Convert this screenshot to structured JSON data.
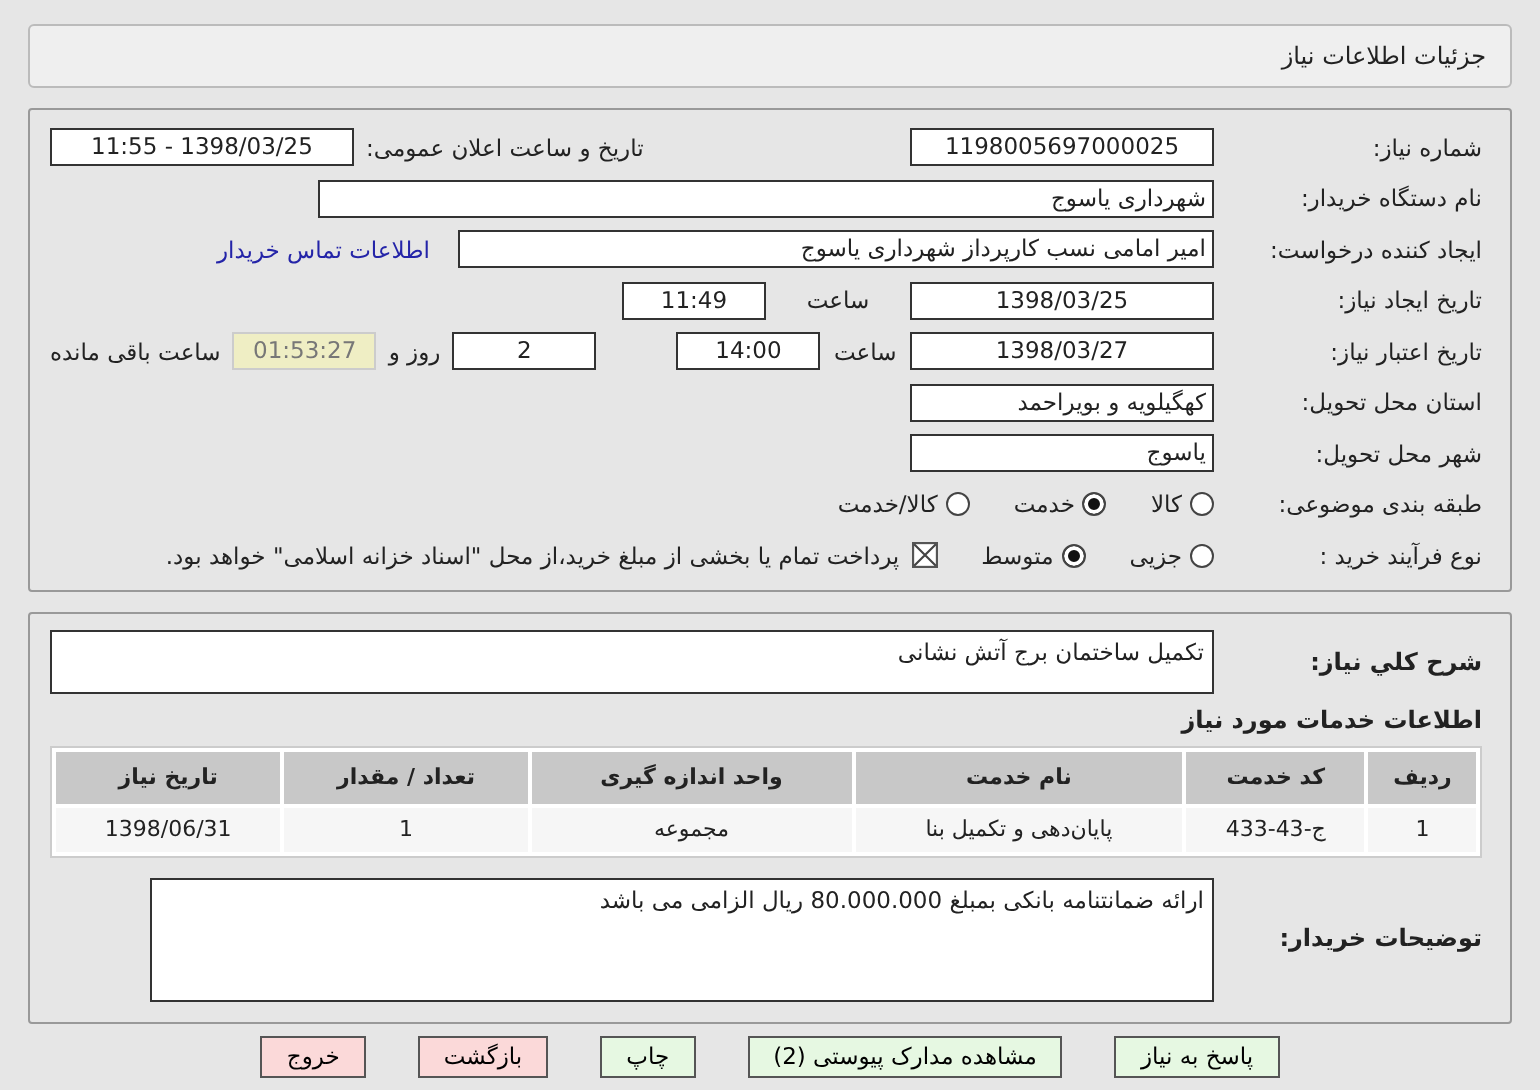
{
  "header": {
    "title": "جزئیات اطلاعات نیاز"
  },
  "details": {
    "need_number": {
      "label": "شماره نیاز:",
      "value": "1198005697000025"
    },
    "announce": {
      "label": "تاریخ و ساعت اعلان عمومی:",
      "value": "1398/03/25 - 11:55"
    },
    "buyer_org": {
      "label": "نام دستگاه خریدار:",
      "value": "شهرداری یاسوج"
    },
    "requester": {
      "label": "ایجاد کننده درخواست:",
      "value": "امیر امامی نسب کارپرداز شهرداری یاسوج",
      "link": "اطلاعات تماس خریدار"
    },
    "created": {
      "label": "تاریخ ایجاد نیاز:",
      "date": "1398/03/25",
      "time_label": "ساعت",
      "time": "11:49"
    },
    "valid": {
      "label": "تاریخ اعتبار نیاز:",
      "date": "1398/03/27",
      "time_label": "ساعت",
      "time": "14:00",
      "days": "2",
      "days_label": "روز و",
      "remaining": "01:53:27",
      "remaining_label": "ساعت باقی مانده"
    },
    "province": {
      "label": "استان محل تحویل:",
      "value": "کهگیلویه و بویراحمد"
    },
    "city": {
      "label": "شهر محل تحویل:",
      "value": "یاسوج"
    },
    "category": {
      "label": "طبقه بندی موضوعی:",
      "options": [
        {
          "label": "کالا",
          "selected": false
        },
        {
          "label": "خدمت",
          "selected": true
        },
        {
          "label": "کالا/خدمت",
          "selected": false
        }
      ]
    },
    "process": {
      "label": "نوع فرآیند خرید :",
      "options": [
        {
          "label": "جزیی",
          "selected": false
        },
        {
          "label": "متوسط",
          "selected": true
        }
      ],
      "treasury": {
        "label": "پرداخت تمام یا بخشی از مبلغ خرید،از محل \"اسناد خزانه اسلامی\" خواهد بود.",
        "checked": true
      }
    }
  },
  "summary": {
    "label": "شرح کلي نیاز:",
    "value": "تکمیل ساختمان برج آتش نشانی"
  },
  "services": {
    "title": "اطلاعات خدمات مورد نیاز",
    "columns": [
      "ردیف",
      "کد خدمت",
      "نام خدمت",
      "واحد اندازه گیری",
      "تعداد / مقدار",
      "تاریخ نیاز"
    ],
    "rows": [
      [
        "1",
        "ج-43-433",
        "پایان‌دهی و تکمیل بنا",
        "مجموعه",
        "1",
        "1398/06/31"
      ]
    ]
  },
  "notes": {
    "label": "توضیحات خریدار:",
    "value": "ارائه ضمانتنامه بانکی بمبلغ 80.000.000 ریال الزامی می باشد"
  },
  "buttons": [
    {
      "label": "پاسخ به نیاز",
      "kind": "normal"
    },
    {
      "label": "مشاهده مدارک پیوستی (2)",
      "kind": "normal"
    },
    {
      "label": "چاپ",
      "kind": "normal"
    },
    {
      "label": "بازگشت",
      "kind": "danger"
    },
    {
      "label": "خروج",
      "kind": "danger"
    }
  ]
}
